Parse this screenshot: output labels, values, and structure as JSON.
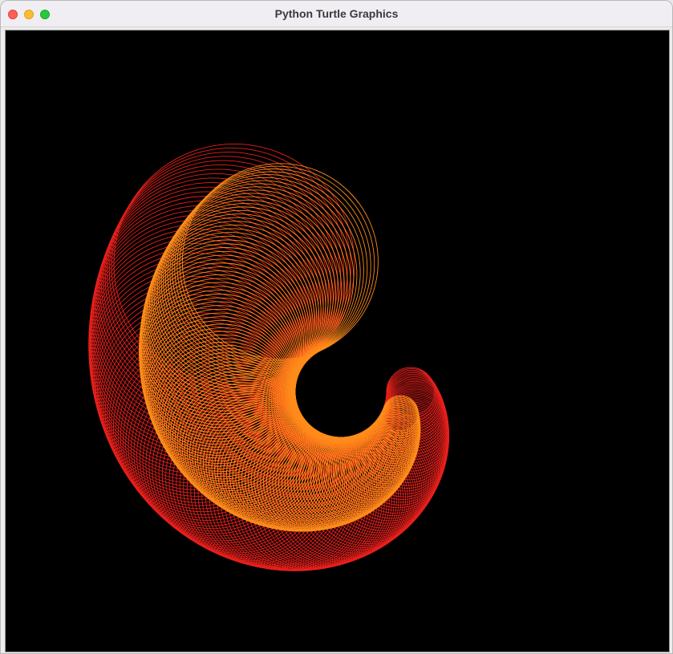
{
  "window": {
    "title": "Python Turtle Graphics"
  },
  "canvas": {
    "background": "#000000",
    "outer_color": "#e8201c",
    "inner_color": "#ff8c1a"
  }
}
